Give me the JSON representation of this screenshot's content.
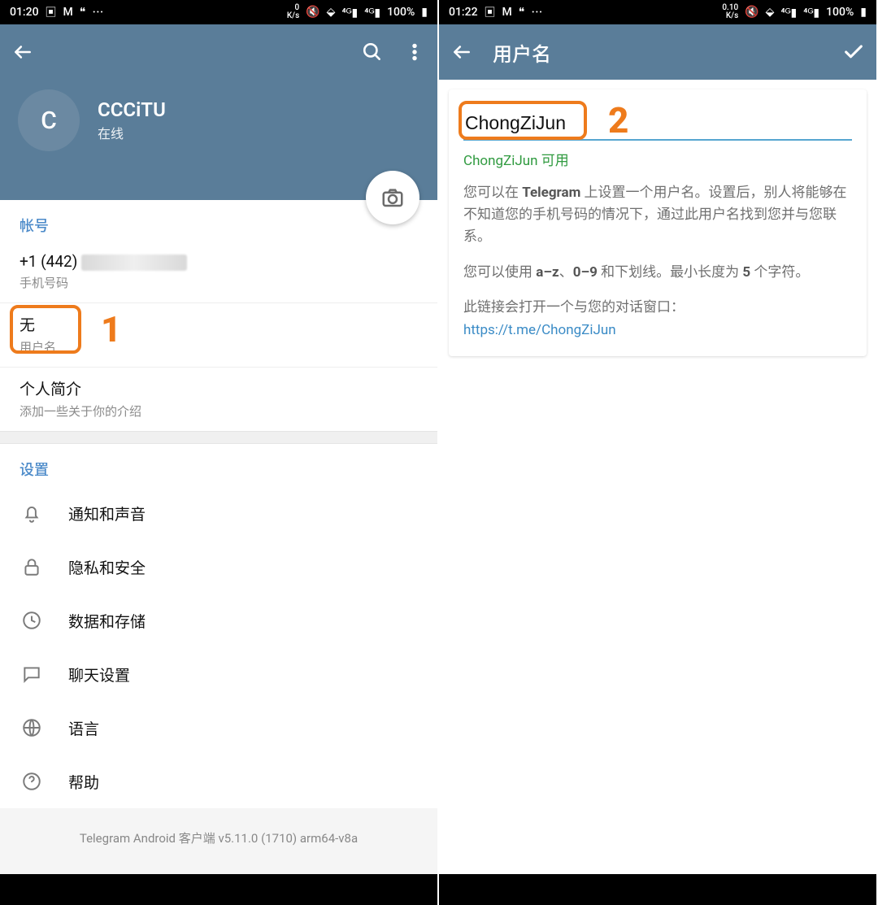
{
  "annotations": {
    "one": "1",
    "two": "2"
  },
  "left": {
    "status": {
      "time": "01:20",
      "speed_top": "0",
      "speed_unit": "K/s",
      "battery": "100%"
    },
    "profile": {
      "avatar_initial": "C",
      "name": "CCCiTU",
      "status": "在线"
    },
    "account": {
      "header": "帐号",
      "phone_value": "+1 (442)",
      "phone_label": "手机号码",
      "username_value": "无",
      "username_label": "用户名",
      "bio_value": "个人简介",
      "bio_label": "添加一些关于你的介绍"
    },
    "settings": {
      "header": "设置",
      "items": [
        {
          "label": "通知和声音"
        },
        {
          "label": "隐私和安全"
        },
        {
          "label": "数据和存储"
        },
        {
          "label": "聊天设置"
        },
        {
          "label": "语言"
        },
        {
          "label": "帮助"
        }
      ]
    },
    "footer": "Telegram Android 客户端 v5.11.0 (1710) arm64-v8a"
  },
  "right": {
    "status": {
      "time": "01:22",
      "speed_top": "0.10",
      "speed_unit": "K/s",
      "battery": "100%"
    },
    "toolbar_title": "用户名",
    "username_value": "ChongZiJun",
    "available_text": "ChongZiJun 可用",
    "desc1_a": "您可以在 ",
    "desc1_b": "Telegram",
    "desc1_c": " 上设置一个用户名。设置后，别人将能够在不知道您的手机号码的情况下，通过此用户名找到您并与您联系。",
    "desc2_a": "您可以使用 ",
    "desc2_b": "a–z",
    "desc2_c": "、",
    "desc2_d": "0–9",
    "desc2_e": " 和下划线。最小长度为 ",
    "desc2_f": "5",
    "desc2_g": " 个字符。",
    "desc3": "此链接会打开一个与您的对话窗口：",
    "link": "https://t.me/ChongZiJun"
  }
}
